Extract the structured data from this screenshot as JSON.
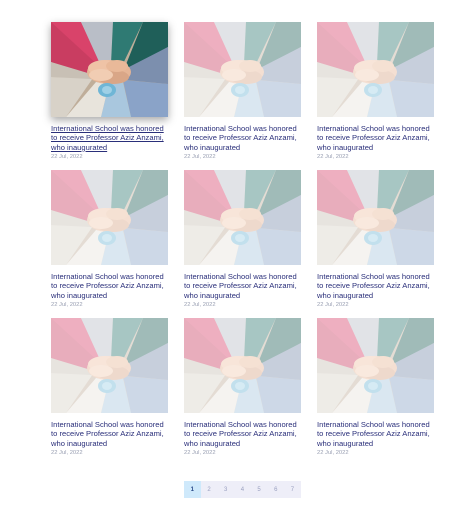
{
  "articles": [
    {
      "title": "International School was honored to receive Professor Aziz Anzami, who inaugurated",
      "date": "22 Jul, 2022"
    },
    {
      "title": "International School was honored to receive Professor Aziz Anzami, who inaugurated",
      "date": "22 Jul, 2022"
    },
    {
      "title": "International School was honored to receive Professor Aziz Anzami, who inaugurated",
      "date": "22 Jul, 2022"
    },
    {
      "title": "International School was honored to receive Professor Aziz Anzami, who inaugurated",
      "date": "22 Jul, 2022"
    },
    {
      "title": "International School was honored to receive Professor Aziz Anzami, who inaugurated",
      "date": "22 Jul, 2022"
    },
    {
      "title": "International School was honored to receive Professor Aziz Anzami, who inaugurated",
      "date": "22 Jul, 2022"
    },
    {
      "title": "International School was honored to receive Professor Aziz Anzami, who inaugurated",
      "date": "22 Jul, 2022"
    },
    {
      "title": "International School was honored to receive Professor Aziz Anzami, who inaugurated",
      "date": "22 Jul, 2022"
    },
    {
      "title": "International School was honored to receive Professor Aziz Anzami, who inaugurated",
      "date": "22 Jul, 2022"
    }
  ],
  "pagination": {
    "pages": [
      "1",
      "2",
      "3",
      "4",
      "5",
      "6",
      "7"
    ],
    "current": "1"
  },
  "colors": {
    "title": "#2a2f7a",
    "date": "#9aa0b3",
    "pager_active": "#cfe9fb",
    "pager_bg": "#eeeef8"
  }
}
